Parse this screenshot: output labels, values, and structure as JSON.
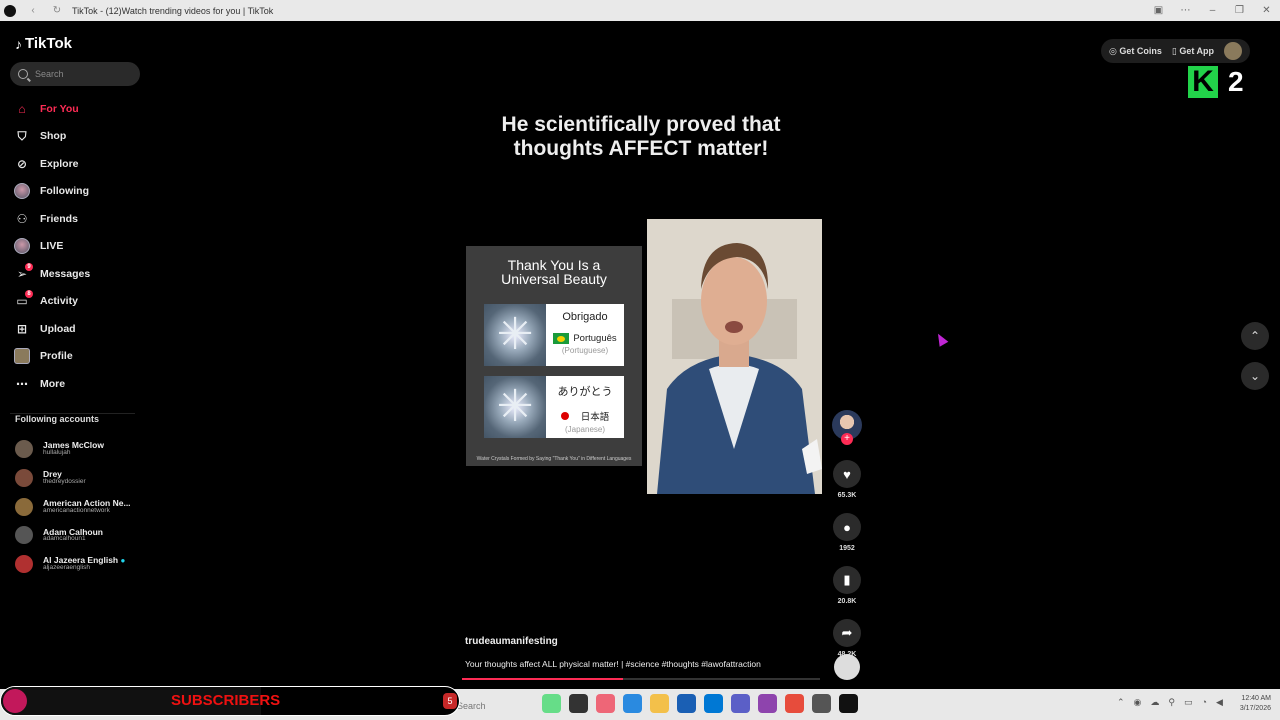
{
  "browser": {
    "tab_title": "TikTok - (12)Watch trending videos for you | TikTok",
    "nav_icons": [
      "back-icon",
      "refresh-icon"
    ],
    "window_controls": [
      "tab-icon",
      "more-icon",
      "minimize-icon",
      "restore-icon",
      "close-icon"
    ]
  },
  "sidebar": {
    "brand": "TikTok",
    "search_placeholder": "Search",
    "nav": [
      {
        "label": "For You",
        "icon": "home-icon",
        "active": true
      },
      {
        "label": "Shop",
        "icon": "shopping-bag-icon"
      },
      {
        "label": "Explore",
        "icon": "compass-icon"
      },
      {
        "label": "Following",
        "icon": "avatar-icon"
      },
      {
        "label": "Friends",
        "icon": "friends-icon"
      },
      {
        "label": "LIVE",
        "icon": "live-icon"
      },
      {
        "label": "Messages",
        "icon": "messages-icon",
        "badge": "9"
      },
      {
        "label": "Activity",
        "icon": "activity-icon",
        "badge": "8"
      },
      {
        "label": "Upload",
        "icon": "upload-icon"
      },
      {
        "label": "Profile",
        "icon": "profile-icon"
      },
      {
        "label": "More",
        "icon": "more-icon"
      }
    ],
    "following_heading": "Following accounts",
    "following": [
      {
        "name": "James McClow",
        "handle": "hullalujah",
        "color": "#6b5b4d"
      },
      {
        "name": "Drey",
        "handle": "thedreydossier",
        "color": "#7a4a3a"
      },
      {
        "name": "American Action Ne...",
        "handle": "americanactionnetwork",
        "color": "#8a6a3a"
      },
      {
        "name": "Adam Calhoun",
        "handle": "adamcalhoun1",
        "color": "#555555"
      },
      {
        "name": "Al Jazeera English",
        "handle": "aljazeeraenglish",
        "color": "#b03030",
        "verified": true
      }
    ]
  },
  "video": {
    "title_line1": "He scientifically proved that",
    "title_line2": "thoughts AFFECT matter!",
    "slide": {
      "heading_line1": "Thank You Is a",
      "heading_line2": "Universal Beauty",
      "cards": [
        {
          "word": "Obrigado",
          "language": "Português",
          "english": "(Portuguese)",
          "flag": "brazil"
        },
        {
          "word": "ありがとう",
          "language": "日本語",
          "english": "(Japanese)",
          "flag": "japan"
        }
      ],
      "footnote": "Water Crystals Formed by Saying \"Thank You\" in Different Languages"
    },
    "author": "trudeaumanifesting",
    "caption": "Your thoughts affect ALL physical matter! | #science #thoughts #lawofattraction",
    "progress_fraction": 0.45
  },
  "actions": [
    {
      "name": "like",
      "icon": "heart-icon",
      "count": "65.3K"
    },
    {
      "name": "comment",
      "icon": "comment-icon",
      "count": "1952"
    },
    {
      "name": "save",
      "icon": "bookmark-icon",
      "count": "20.8K"
    },
    {
      "name": "share",
      "icon": "share-icon",
      "count": "48.2K"
    }
  ],
  "topbar": {
    "get_coins": "Get Coins",
    "get_app": "Get App"
  },
  "overlay": {
    "k_logo": "K",
    "k_number": "2",
    "subscribers_label": "SUBSCRIBERS",
    "subscribers_count": "5"
  },
  "taskbar": {
    "search_placeholder": "Search",
    "time": "12:40 AM",
    "date": "3/17/2026"
  }
}
